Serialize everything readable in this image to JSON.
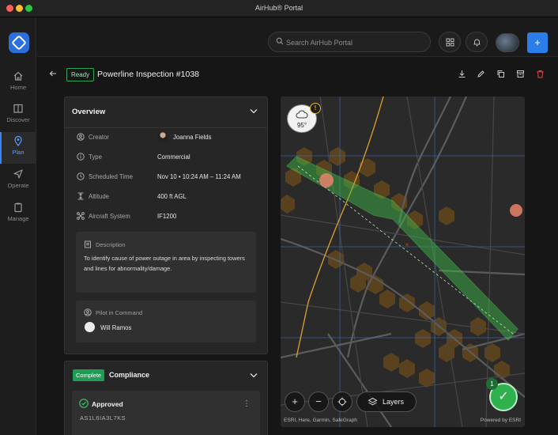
{
  "window": {
    "title": "AirHub® Portal"
  },
  "sidebar": {
    "items": [
      {
        "label": "Home",
        "icon": "home-icon"
      },
      {
        "label": "Discover",
        "icon": "book-icon"
      },
      {
        "label": "Plan",
        "icon": "map-pin-icon",
        "active": true
      },
      {
        "label": "Operate",
        "icon": "send-icon"
      },
      {
        "label": "Manage",
        "icon": "clipboard-icon"
      }
    ]
  },
  "topbar": {
    "search_placeholder": "Search AirHub Portal",
    "add_label": "+"
  },
  "header": {
    "status": "Ready",
    "title": "Powerline Inspection #1038"
  },
  "overview": {
    "title": "Overview",
    "rows": [
      {
        "label": "Creator",
        "value": "Joanna Fields"
      },
      {
        "label": "Type",
        "value": "Commercial"
      },
      {
        "label": "Scheduled Time",
        "value": "Nov 10 • 10:24 AM – 11:24 AM"
      },
      {
        "label": "Altitude",
        "value": "400 ft AGL"
      },
      {
        "label": "Aircraft System",
        "value": "IF1200"
      }
    ],
    "description": {
      "label": "Description",
      "text": "To identify cause of power outage in area by inspecting towers and lines for abnormality/damage."
    },
    "pilot": {
      "label": "Pilot in Command",
      "name": "Will Ramos"
    }
  },
  "compliance": {
    "status": "Complete",
    "title": "Compliance",
    "approval": {
      "title": "Approved",
      "code": "AS1L6IA3L7KS"
    }
  },
  "map": {
    "temperature": "95°",
    "warning": "!",
    "layers_label": "Layers",
    "zoom_in": "+",
    "zoom_out": "−",
    "attribution": "ESRI, Here, Garmin, SafeGraph",
    "powered_by": "Powered by ESRI",
    "check_count": "1",
    "check_mark": "✓",
    "colors": {
      "corridor": "#3fbf4a",
      "hex": "#6b4a1a",
      "road": "#d29a2e",
      "grid": "#3c6fb0"
    }
  }
}
